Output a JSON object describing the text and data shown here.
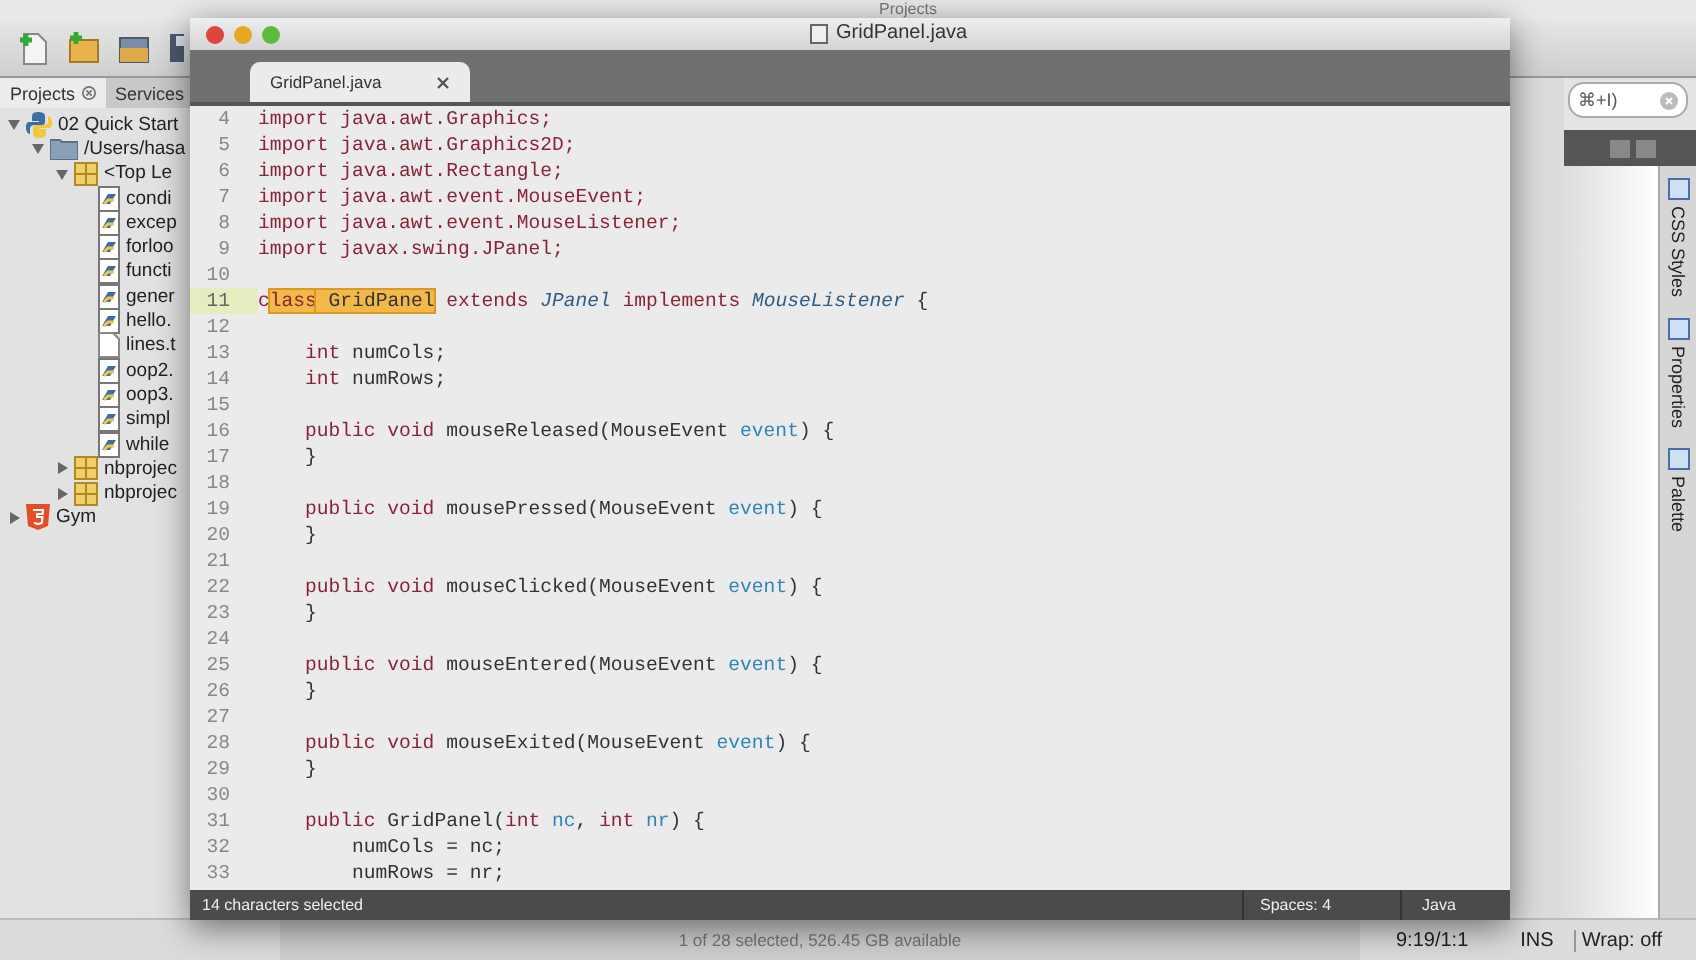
{
  "background_window": {
    "title": "Projects",
    "toolbar": [
      {
        "kind": "new-file"
      },
      {
        "kind": "new-project"
      },
      {
        "kind": "open-project"
      },
      {
        "kind": "save"
      }
    ],
    "panel_tabs": [
      {
        "label": "Projects",
        "selected": true
      },
      {
        "label": "Services",
        "selected": false
      }
    ],
    "tree": [
      {
        "label": "02 Quick Start",
        "kind": "python",
        "expanded": true,
        "children": [
          {
            "label": "/Users/hasa",
            "kind": "folder",
            "expanded": true,
            "children": [
              {
                "label": "<Top Le",
                "kind": "package",
                "expanded": true,
                "children": [
                  {
                    "label": "condi",
                    "kind": "python-file"
                  },
                  {
                    "label": "excep",
                    "kind": "python-file"
                  },
                  {
                    "label": "forloo",
                    "kind": "python-file"
                  },
                  {
                    "label": "functi",
                    "kind": "python-file"
                  },
                  {
                    "label": "gener",
                    "kind": "python-file"
                  },
                  {
                    "label": "hello.",
                    "kind": "python-file"
                  },
                  {
                    "label": "lines.t",
                    "kind": "text-file"
                  },
                  {
                    "label": "oop2.",
                    "kind": "python-file"
                  },
                  {
                    "label": "oop3.",
                    "kind": "python-file"
                  },
                  {
                    "label": "simpl",
                    "kind": "python-file"
                  },
                  {
                    "label": "while",
                    "kind": "python-file"
                  }
                ]
              },
              {
                "label": "nbprojec",
                "kind": "package",
                "expanded": false
              },
              {
                "label": "nbprojec",
                "kind": "package",
                "expanded": false
              }
            ]
          }
        ]
      },
      {
        "label": "Gym",
        "kind": "html",
        "expanded": false
      }
    ],
    "search": {
      "value": "⌘+I)"
    },
    "side_tabs": [
      {
        "label": "CSS Styles"
      },
      {
        "label": "Properties"
      },
      {
        "label": "Palette"
      }
    ],
    "finder_status": "1 of 28 selected, 526.45 GB available",
    "status_bar": {
      "position": "9:19/1:1",
      "mode": "INS",
      "wrap": "Wrap: off"
    }
  },
  "editor": {
    "title": "GridPanel.java",
    "tabs": [
      {
        "label": "GridPanel.java",
        "selected": true
      }
    ],
    "lines": [
      {
        "number": "4",
        "current": false,
        "tokens": [
          {
            "text": "import java.awt.Graphics;",
            "kind": "kw"
          }
        ]
      },
      {
        "number": "5",
        "current": false,
        "tokens": [
          {
            "text": "import java.awt.Graphics2D;",
            "kind": "kw"
          }
        ]
      },
      {
        "number": "6",
        "current": false,
        "tokens": [
          {
            "text": "import java.awt.Rectangle;",
            "kind": "kw"
          }
        ]
      },
      {
        "number": "7",
        "current": false,
        "tokens": [
          {
            "text": "import java.awt.event.MouseEvent;",
            "kind": "kw"
          }
        ]
      },
      {
        "number": "8",
        "current": false,
        "tokens": [
          {
            "text": "import java.awt.event.MouseListener;",
            "kind": "kw"
          }
        ]
      },
      {
        "number": "9",
        "current": false,
        "tokens": [
          {
            "text": "import javax.swing.JPanel;",
            "kind": "kw"
          }
        ]
      },
      {
        "number": "10",
        "current": false
      },
      {
        "number": "11",
        "current": true,
        "tokens": [
          {
            "text": "c",
            "kind": "kw"
          },
          {
            "text": "lass",
            "kind": "selected-kw"
          },
          {
            "text": " GridPanel",
            "kind": "selected-plain"
          },
          {
            "text": " extends ",
            "kind": "kw"
          },
          {
            "text": "JPanel",
            "kind": "type"
          },
          {
            "text": " implements ",
            "kind": "kw"
          },
          {
            "text": "MouseListener",
            "kind": "type"
          },
          {
            "text": " {",
            "kind": "plain"
          }
        ]
      },
      {
        "number": "12",
        "current": false
      },
      {
        "number": "13",
        "current": false,
        "tokens": [
          {
            "text": "    int",
            "kind": "kw"
          },
          {
            "text": " numCols;",
            "kind": "plain"
          }
        ]
      },
      {
        "number": "14",
        "current": false,
        "tokens": [
          {
            "text": "    int",
            "kind": "kw"
          },
          {
            "text": " numRows;",
            "kind": "plain"
          }
        ]
      },
      {
        "number": "15",
        "current": false
      },
      {
        "number": "16",
        "current": false,
        "tokens": [
          {
            "text": "    public void",
            "kind": "kw"
          },
          {
            "text": " mouseReleased(MouseEvent ",
            "kind": "plain"
          },
          {
            "text": "event",
            "kind": "param"
          },
          {
            "text": ") {",
            "kind": "plain"
          }
        ]
      },
      {
        "number": "17",
        "current": false,
        "tokens": [
          {
            "text": "    }",
            "kind": "plain"
          }
        ]
      },
      {
        "number": "18",
        "current": false
      },
      {
        "number": "19",
        "current": false,
        "tokens": [
          {
            "text": "    public void",
            "kind": "kw"
          },
          {
            "text": " mousePressed(MouseEvent ",
            "kind": "plain"
          },
          {
            "text": "event",
            "kind": "param"
          },
          {
            "text": ") {",
            "kind": "plain"
          }
        ]
      },
      {
        "number": "20",
        "current": false,
        "tokens": [
          {
            "text": "    }",
            "kind": "plain"
          }
        ]
      },
      {
        "number": "21",
        "current": false
      },
      {
        "number": "22",
        "current": false,
        "tokens": [
          {
            "text": "    public void",
            "kind": "kw"
          },
          {
            "text": " mouseClicked(MouseEvent ",
            "kind": "plain"
          },
          {
            "text": "event",
            "kind": "param"
          },
          {
            "text": ") {",
            "kind": "plain"
          }
        ]
      },
      {
        "number": "23",
        "current": false,
        "tokens": [
          {
            "text": "    }",
            "kind": "plain"
          }
        ]
      },
      {
        "number": "24",
        "current": false
      },
      {
        "number": "25",
        "current": false,
        "tokens": [
          {
            "text": "    public void",
            "kind": "kw"
          },
          {
            "text": " mouseEntered(MouseEvent ",
            "kind": "plain"
          },
          {
            "text": "event",
            "kind": "param"
          },
          {
            "text": ") {",
            "kind": "plain"
          }
        ]
      },
      {
        "number": "26",
        "current": false,
        "tokens": [
          {
            "text": "    }",
            "kind": "plain"
          }
        ]
      },
      {
        "number": "27",
        "current": false
      },
      {
        "number": "28",
        "current": false,
        "tokens": [
          {
            "text": "    public void",
            "kind": "kw"
          },
          {
            "text": " mouseExited(MouseEvent ",
            "kind": "plain"
          },
          {
            "text": "event",
            "kind": "param"
          },
          {
            "text": ") {",
            "kind": "plain"
          }
        ]
      },
      {
        "number": "29",
        "current": false,
        "tokens": [
          {
            "text": "    }",
            "kind": "plain"
          }
        ]
      },
      {
        "number": "30",
        "current": false
      },
      {
        "number": "31",
        "current": false,
        "tokens": [
          {
            "text": "    public",
            "kind": "kw"
          },
          {
            "text": " GridPanel(",
            "kind": "plain"
          },
          {
            "text": "int",
            "kind": "kw"
          },
          {
            "text": " nc",
            "kind": "param"
          },
          {
            "text": ", ",
            "kind": "plain"
          },
          {
            "text": "int",
            "kind": "kw"
          },
          {
            "text": " nr",
            "kind": "param"
          },
          {
            "text": ") {",
            "kind": "plain"
          }
        ]
      },
      {
        "number": "32",
        "current": false,
        "tokens": [
          {
            "text": "        numCols = nc;",
            "kind": "plain"
          }
        ]
      },
      {
        "number": "33",
        "current": false,
        "tokens": [
          {
            "text": "        numRows = nr;",
            "kind": "plain"
          }
        ]
      }
    ],
    "status_bar": {
      "selection": "14 characters selected",
      "indent": "Spaces: 4",
      "syntax": "Java"
    }
  }
}
